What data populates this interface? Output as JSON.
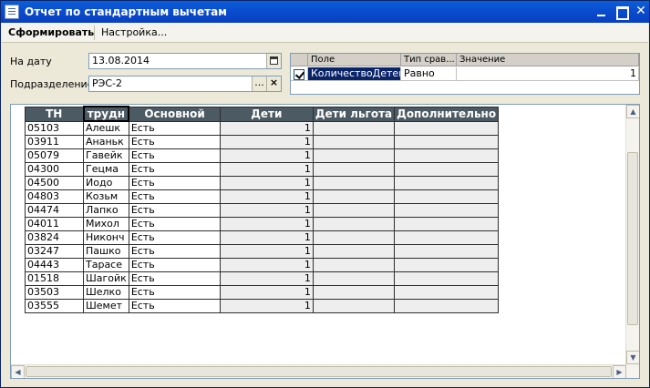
{
  "window": {
    "title": "Отчет по стандартным вычетам",
    "minimize_icon": "minimize-icon",
    "maximize_icon": "maximize-icon",
    "close_label": "✕"
  },
  "toolbar": {
    "generate_label": "Сформировать",
    "settings_label": "Настройка..."
  },
  "form": {
    "date_label": "На дату",
    "date_value": "13.08.2014",
    "department_label": "Подразделение",
    "department_value": "РЭС-2",
    "select_label": "...",
    "clear_label": "×"
  },
  "filter": {
    "columns": [
      "Поле",
      "Тип срав...",
      "Значение"
    ],
    "row": {
      "checked": true,
      "field": "КоличествоДетей",
      "comparison": "Равно",
      "value": "1"
    }
  },
  "report": {
    "columns": [
      "ТН",
      "трудн",
      "Основной",
      "Дети",
      "Дети льгота",
      "Дополнительно"
    ],
    "rows": [
      [
        "05103",
        "Алешк",
        "Есть",
        "1",
        "",
        ""
      ],
      [
        "03911",
        "Ананьк",
        "Есть",
        "1",
        "",
        ""
      ],
      [
        "05079",
        "Гавейк",
        "Есть",
        "1",
        "",
        ""
      ],
      [
        "04300",
        "Гецма",
        "Есть",
        "1",
        "",
        ""
      ],
      [
        "04500",
        "Иодо",
        "Есть",
        "1",
        "",
        ""
      ],
      [
        "04803",
        "Козьм",
        "Есть",
        "1",
        "",
        ""
      ],
      [
        "04474",
        "Лапко",
        "Есть",
        "1",
        "",
        ""
      ],
      [
        "04011",
        "Михол",
        "Есть",
        "1",
        "",
        ""
      ],
      [
        "03824",
        "Никонч",
        "Есть",
        "1",
        "",
        ""
      ],
      [
        "03247",
        "Пашко",
        "Есть",
        "1",
        "",
        ""
      ],
      [
        "04443",
        "Тарасе",
        "Есть",
        "1",
        "",
        ""
      ],
      [
        "01518",
        "Шагойк",
        "Есть",
        "1",
        "",
        ""
      ],
      [
        "03503",
        "Шелко",
        "Есть",
        "1",
        "",
        ""
      ],
      [
        "03555",
        "Шемет",
        "Есть",
        "1",
        "",
        ""
      ]
    ]
  },
  "scrollbars": {
    "up_arrow": "▲",
    "down_arrow": "▼",
    "left_arrow": "◀",
    "right_arrow": "▶"
  }
}
